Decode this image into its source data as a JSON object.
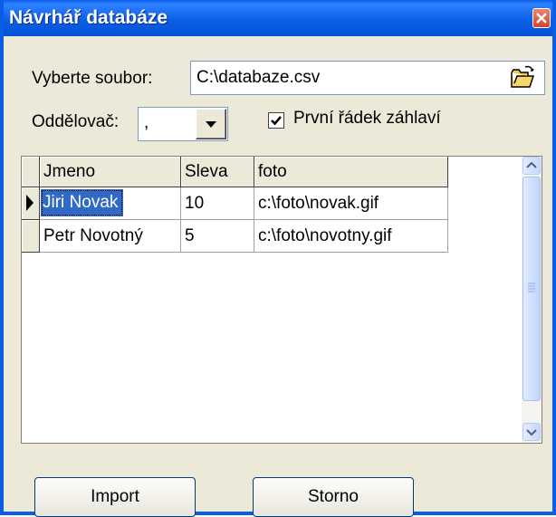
{
  "window": {
    "title": "Návrhář databáze"
  },
  "file": {
    "label": "Vyberte soubor:",
    "value": "C:\\databaze.csv"
  },
  "separator": {
    "label": "Oddělovač:",
    "value": ","
  },
  "header_checkbox": {
    "label": "První řádek záhlaví",
    "checked": true
  },
  "table": {
    "columns": [
      "Jmeno",
      "Sleva",
      "foto"
    ],
    "rows": [
      [
        "Jiri Novak",
        "10",
        "c:\\foto\\novak.gif"
      ],
      [
        "Petr Novotný",
        "5",
        "c:\\foto\\novotny.gif"
      ]
    ],
    "selected_row": 0
  },
  "buttons": {
    "import": "Import",
    "cancel": "Storno"
  },
  "icons": {
    "close": "close-icon",
    "folder": "folder-open-icon",
    "row_pointer": "row-pointer-icon"
  }
}
